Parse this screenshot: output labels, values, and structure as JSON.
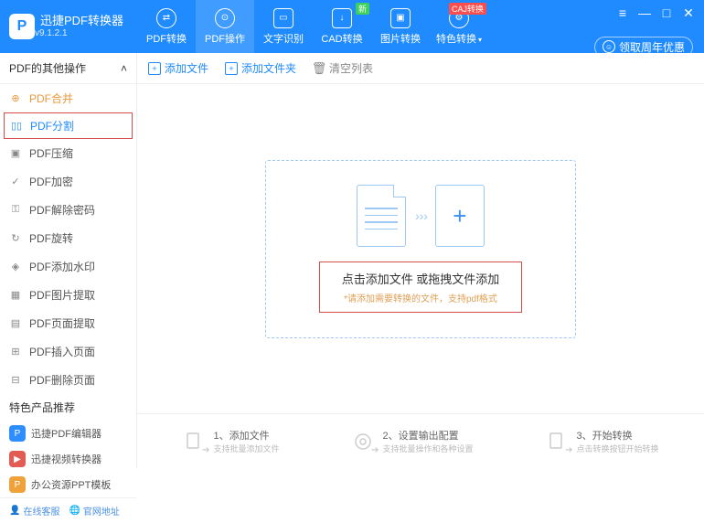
{
  "app": {
    "name": "迅捷PDF转换器",
    "version": "v9.1.2.1"
  },
  "header": {
    "tabs": [
      {
        "label": "PDF转换",
        "icon": "⇄"
      },
      {
        "label": "PDF操作",
        "icon": "⊙",
        "active": true
      },
      {
        "label": "文字识别",
        "icon": "▭"
      },
      {
        "label": "CAD转换",
        "icon": "↓",
        "badge": "新",
        "badgeColor": "green"
      },
      {
        "label": "图片转换",
        "icon": "▣"
      },
      {
        "label": "特色转换",
        "icon": "⚙",
        "badge": "CAJ转换",
        "badgeColor": "red",
        "dropdown": true
      }
    ],
    "user_btn": "领取周年优惠"
  },
  "sidebar": {
    "section_title": "PDF的其他操作",
    "items": [
      {
        "label": "PDF合并",
        "icon": "⊕"
      },
      {
        "label": "PDF分割",
        "icon": "▯▯",
        "selected": true
      },
      {
        "label": "PDF压缩",
        "icon": "▣"
      },
      {
        "label": "PDF加密",
        "icon": "✓"
      },
      {
        "label": "PDF解除密码",
        "icon": "⚿"
      },
      {
        "label": "PDF旋转",
        "icon": "↻"
      },
      {
        "label": "PDF添加水印",
        "icon": "◈"
      },
      {
        "label": "PDF图片提取",
        "icon": "▦"
      },
      {
        "label": "PDF页面提取",
        "icon": "▤"
      },
      {
        "label": "PDF插入页面",
        "icon": "⊞"
      },
      {
        "label": "PDF删除页面",
        "icon": "⊟"
      }
    ],
    "rec_title": "特色产品推荐",
    "recs": [
      {
        "label": "迅捷PDF编辑器",
        "color": "blue",
        "glyph": "P"
      },
      {
        "label": "迅捷视频转换器",
        "color": "red",
        "glyph": "▶"
      },
      {
        "label": "办公资源PPT模板",
        "color": "orange",
        "glyph": "P"
      }
    ],
    "foot": {
      "service": "在线客服",
      "site": "官网地址"
    }
  },
  "toolbar": {
    "add_file": "添加文件",
    "add_folder": "添加文件夹",
    "clear": "清空列表"
  },
  "drop": {
    "title": "点击添加文件 或拖拽文件添加",
    "sub": "*请添加需要转换的文件，支持pdf格式"
  },
  "steps": [
    {
      "title": "1、添加文件",
      "sub": "支持批量添加文件"
    },
    {
      "title": "2、设置输出配置",
      "sub": "支持批量操作和各种设置"
    },
    {
      "title": "3、开始转换",
      "sub": "点击转换按钮开始转换"
    }
  ]
}
